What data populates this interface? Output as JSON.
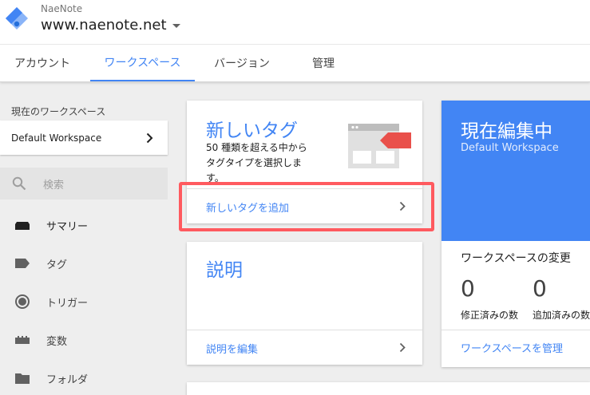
{
  "header": {
    "account_name": "NaeNote",
    "container_name": "www.naenote.net"
  },
  "tabs": [
    {
      "label": "アカウント"
    },
    {
      "label": "ワークスペース"
    },
    {
      "label": "バージョン"
    },
    {
      "label": "管理"
    }
  ],
  "sidebar": {
    "workspace_heading": "現在のワークスペース",
    "workspace_name": "Default Workspace",
    "search_placeholder": "検索",
    "items": [
      {
        "label": "サマリー"
      },
      {
        "label": "タグ"
      },
      {
        "label": "トリガー"
      },
      {
        "label": "変数"
      },
      {
        "label": "フォルダ"
      }
    ]
  },
  "new_tag_card": {
    "title": "新しいタグ",
    "desc_line1": "50 種類を超える中から",
    "desc_line2": "タグタイプを選択しま",
    "desc_line3": "す。",
    "link": "新しいタグを追加"
  },
  "description_card": {
    "title": "説明",
    "link": "説明を編集"
  },
  "editing_card": {
    "title": "現在編集中",
    "workspace": "Default Workspace",
    "changes_title": "ワークスペースの変更",
    "modified_count": "0",
    "modified_label": "修正済みの数",
    "added_count": "0",
    "added_label": "追加済みの数",
    "manage_link": "ワークスペースを管理"
  },
  "colors": {
    "accent": "#4285f4",
    "highlight": "#ff5a5f",
    "tag_illustration_red": "#e9504b"
  }
}
